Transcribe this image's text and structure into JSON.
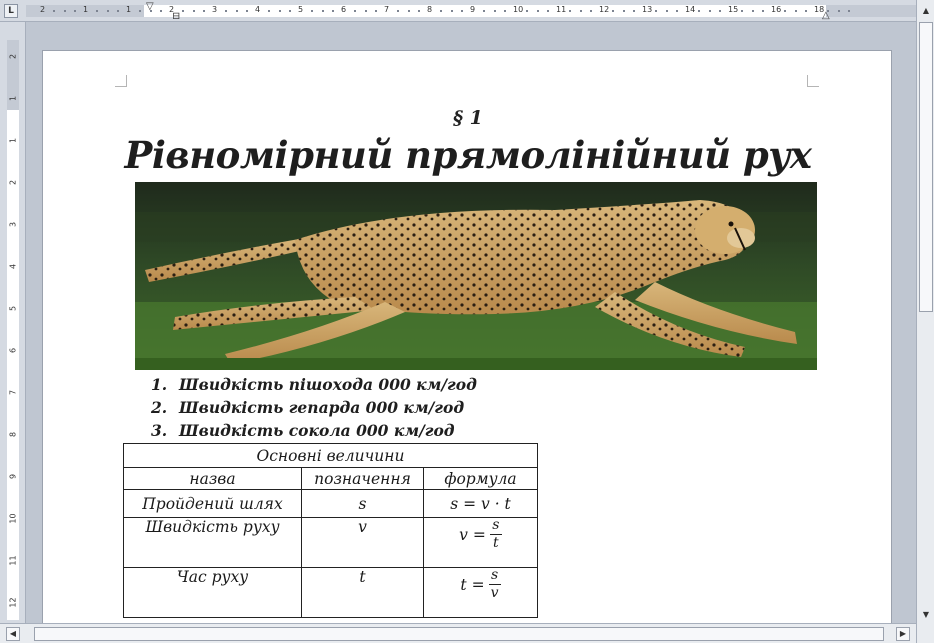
{
  "ruler": {
    "corner_label": "L",
    "numbers": [
      "2",
      "1",
      "1",
      "2",
      "3",
      "4",
      "5",
      "6",
      "7",
      "8",
      "9",
      "10",
      "11",
      "12",
      "13",
      "14",
      "15",
      "16",
      "18"
    ],
    "vnumbers": [
      "2",
      "1",
      "1",
      "2",
      "3",
      "4",
      "5",
      "6",
      "7",
      "8",
      "9",
      "10",
      "11",
      "12"
    ]
  },
  "document": {
    "section_sign": "§ 1",
    "title": "Рівномірний прямолінійний рух",
    "image_icon": "cheetah-photo",
    "questions": [
      {
        "num": "1.",
        "text": "Швидкість пішохода 000 км/год"
      },
      {
        "num": "2.",
        "text": "Швидкість гепарда 000 км/год"
      },
      {
        "num": "3.",
        "text": "Швидкість сокола 000 км/год"
      }
    ],
    "table": {
      "header": "Основні величини",
      "columns": [
        "назва",
        "позначення",
        "формула"
      ],
      "rows": [
        {
          "name": "Пройдений шлях",
          "symbol": "s",
          "formula": "s = v · t"
        },
        {
          "name": "Швидкість руху",
          "symbol": "v",
          "formula_lhs": "v =",
          "num": "s",
          "den": "t"
        },
        {
          "name": "Час руху",
          "symbol": "t",
          "formula_lhs": "t =",
          "num": "s",
          "den": "v"
        }
      ]
    }
  },
  "scrollbars": {
    "up_arrow": "▲",
    "down_arrow": "▼",
    "left_arrow": "◀",
    "right_arrow": "▶"
  }
}
